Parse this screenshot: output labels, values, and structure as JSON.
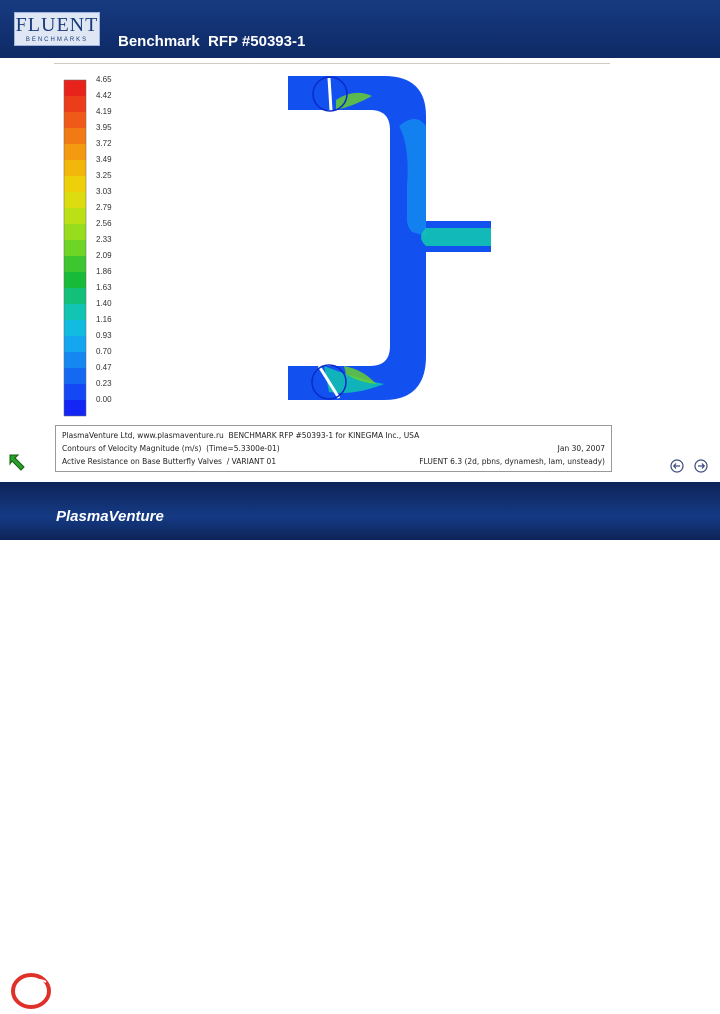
{
  "header": {
    "logo_text": "FLUENT",
    "logo_subtext": "BENCHMARKS",
    "title": "Benchmark  RFP #50393-1"
  },
  "legend": {
    "values": [
      "4.65",
      "4.42",
      "4.19",
      "3.95",
      "3.72",
      "3.49",
      "3.25",
      "3.03",
      "2.79",
      "2.56",
      "2.33",
      "2.09",
      "1.86",
      "1.63",
      "1.40",
      "1.16",
      "0.93",
      "0.70",
      "0.47",
      "0.23",
      "0.00"
    ],
    "colors": [
      "#e8231c",
      "#ec3d1a",
      "#f05a18",
      "#f27a14",
      "#f49a10",
      "#f3b70c",
      "#eed00a",
      "#dcdc10",
      "#bce016",
      "#98dc1e",
      "#6ed426",
      "#3ec630",
      "#18ba3a",
      "#12c07a",
      "#12c4b2",
      "#12bce0",
      "#14a6ee",
      "#1488f0",
      "#1468f2",
      "#1448f4",
      "#1426f6"
    ]
  },
  "simulation": {
    "colors": {
      "pipe": "#1250f0",
      "mid": "#1488f0",
      "high": "#12c4b2",
      "accent": "#6ed426",
      "edge": "#0a2ac8"
    }
  },
  "caption": {
    "left": [
      "PlasmaVenture Ltd, www.plasmaventure.ru  BENCHMARK RFP #50393-1 for KINEGMA Inc., USA",
      "Contours of Velocity Magnitude (m/s)  (Time=5.3300e-01)",
      "Active Resistance on Base Butterfly Valves  / VARIANT 01"
    ],
    "right": [
      "Jan 30, 2007",
      "FLUENT 6.3 (2d, pbns, dynamesh, lam, unsteady)"
    ]
  },
  "footer": {
    "brand": "PlasmaVenture"
  }
}
